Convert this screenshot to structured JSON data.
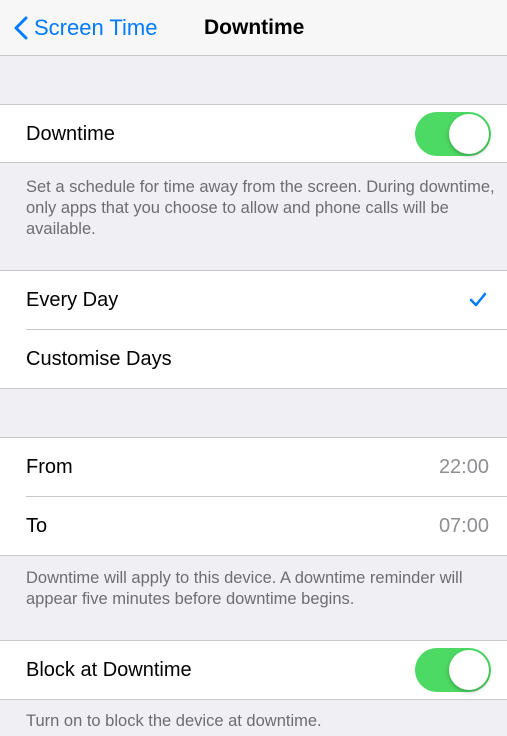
{
  "nav": {
    "back_label": "Screen Time",
    "title": "Downtime"
  },
  "downtime_group": {
    "toggle_label": "Downtime",
    "toggle_on": true,
    "footer": "Set a schedule for time away from the screen. During downtime, only apps that you choose to allow and phone calls will be available."
  },
  "days_group": {
    "items": [
      {
        "label": "Every Day",
        "selected": true
      },
      {
        "label": "Customise Days",
        "selected": false
      }
    ]
  },
  "time_group": {
    "from_label": "From",
    "from_value": "22:00",
    "to_label": "To",
    "to_value": "07:00",
    "footer": "Downtime will apply to this device. A downtime reminder will appear five minutes before downtime begins."
  },
  "block_group": {
    "toggle_label": "Block at Downtime",
    "toggle_on": true,
    "footer": "Turn on to block the device at downtime."
  },
  "colors": {
    "accent": "#007aff",
    "toggle_on": "#4cd964",
    "background": "#efeff4",
    "secondary_text": "#8e8e93"
  }
}
